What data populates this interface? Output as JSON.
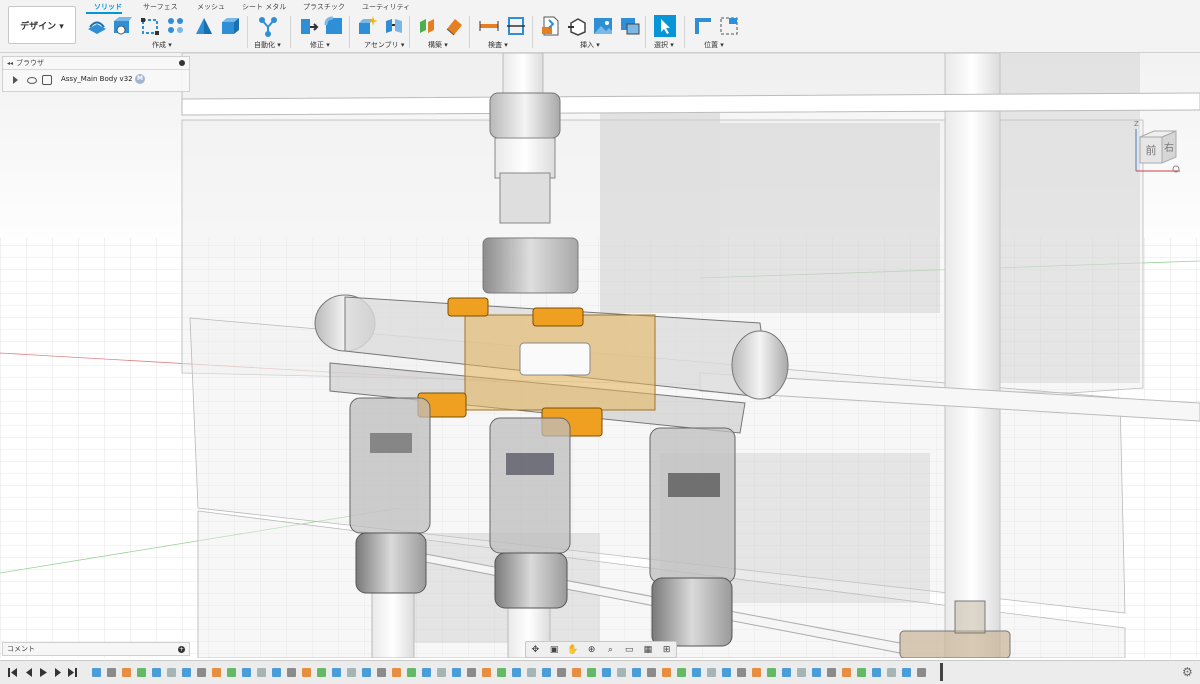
{
  "toolbar": {
    "workspace_button": "デザイン ▾",
    "tabs": [
      "ソリッド",
      "サーフェス",
      "メッシュ",
      "シート メタル",
      "プラスチック",
      "ユーティリティ"
    ],
    "groups": [
      "作成 ▾",
      "自動化 ▾",
      "修正 ▾",
      "アセンブリ ▾",
      "構築 ▾",
      "検査 ▾",
      "挿入 ▾",
      "選択 ▾",
      "位置 ▾"
    ],
    "accent_color": "#0696d7"
  },
  "browser": {
    "title": "ブラウザ",
    "root_label": "Assy_Main Body v32",
    "badge": "M"
  },
  "comment_panel": {
    "title": "コメント"
  },
  "viewcube": {
    "front": "前",
    "right": "右",
    "axis_z": "Z"
  },
  "nav_icons": [
    "orbit-icon",
    "look-at-icon",
    "pan-icon",
    "zoom-window-icon",
    "zoom-icon",
    "display-mode-icon",
    "grid-icon",
    "viewports-icon"
  ],
  "timeline": {
    "settings_icon": "gear-icon"
  }
}
